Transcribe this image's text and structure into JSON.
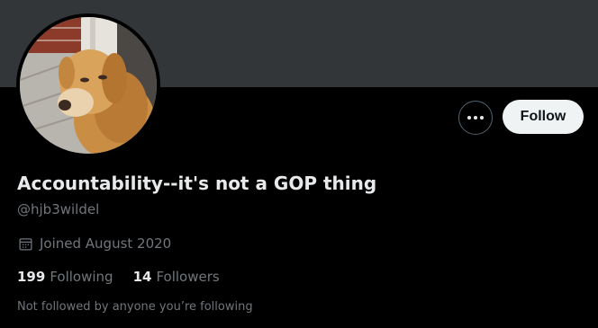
{
  "profile": {
    "display_name": "Accountability--it's not a GOP thing",
    "handle": "@hjb3wildel",
    "joined": "Joined August 2020",
    "follow_label": "Follow",
    "more_icon": "more-horizontal-icon",
    "calendar_icon": "calendar-icon",
    "avatar_description": "golden retriever on porch"
  },
  "stats": {
    "following_count": "199",
    "following_label": "Following",
    "followers_count": "14",
    "followers_label": "Followers"
  },
  "social_context": "Not followed by anyone you’re following",
  "colors": {
    "background": "#000000",
    "banner": "#333639",
    "primary_text": "#e7e9ea",
    "secondary_text": "#71767b",
    "follow_button_bg": "#eff3f4",
    "follow_button_text": "#0f1419"
  }
}
